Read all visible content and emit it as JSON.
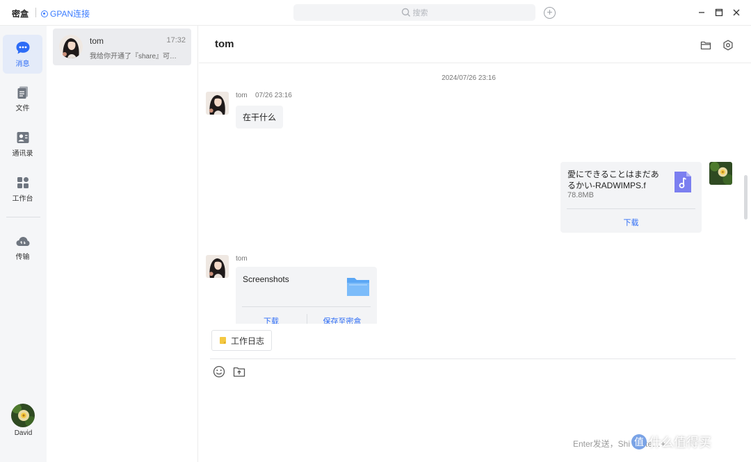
{
  "titlebar": {
    "app_name": "密盒",
    "gpan_label": "GPAN连接",
    "search_placeholder": "搜索"
  },
  "sidebar": {
    "items": [
      {
        "label": "消息"
      },
      {
        "label": "文件"
      },
      {
        "label": "通讯录"
      },
      {
        "label": "工作台"
      },
      {
        "label": "传输"
      }
    ],
    "user_name": "David"
  },
  "conversations": [
    {
      "name": "tom",
      "time": "17:32",
      "preview": "我给你开通了『share』可…"
    }
  ],
  "chat": {
    "title": "tom",
    "date_separator": "2024/07/26 23:16",
    "messages": [
      {
        "sender": "tom",
        "time": "07/26 23:16",
        "text": "在干什么"
      },
      {
        "file_name": "愛にできることはまだあるかい-RADWIMPS.f",
        "file_size": "78.8MB",
        "action": "下载"
      },
      {
        "sender": "tom",
        "file_name": "Screenshots",
        "actions": [
          "下载",
          "保存至密盒"
        ]
      }
    ]
  },
  "composer": {
    "quick_tag": "工作日志",
    "send_hint": "Enter发送，Shi",
    "send_hint_tail": "te…+"
  },
  "watermark": {
    "badge": "值",
    "text": "什么值得买"
  },
  "colors": {
    "accent": "#2d6cf6",
    "gpan": "#3a7bff",
    "bubble": "#f3f4f6"
  }
}
